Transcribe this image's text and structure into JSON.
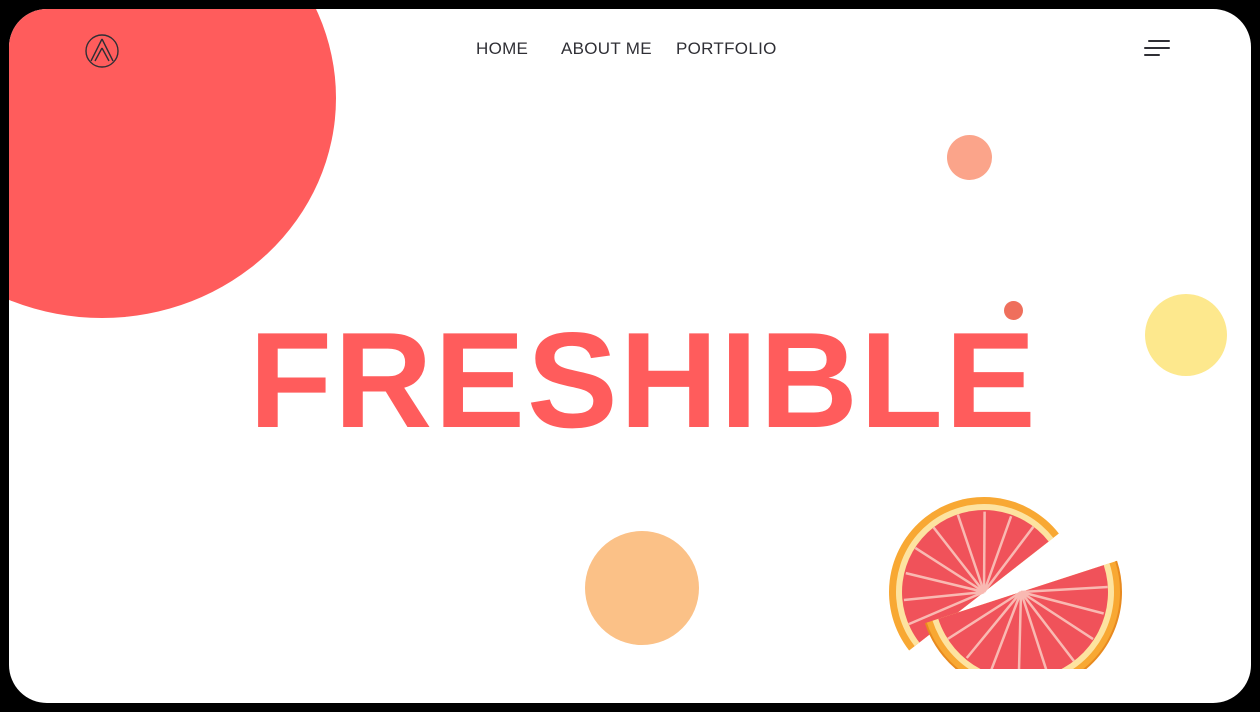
{
  "colors": {
    "brand": "#ff5c5c",
    "pink_dot": "#fba48a",
    "red_dot": "#ef6f5c",
    "yellow": "#fde88d",
    "peach": "#fbc187",
    "text": "#2f2f35"
  },
  "header": {
    "logo_icon": "triangle-circle-logo-icon",
    "menu_icon": "hamburger-menu-icon"
  },
  "nav": {
    "items": [
      {
        "label": "HOME"
      },
      {
        "label": "ABOUT ME"
      },
      {
        "label": "PORTFOLIO"
      }
    ]
  },
  "hero": {
    "title": "FRESHIBLE"
  },
  "illustration": {
    "icon": "grapefruit-slices-icon"
  }
}
